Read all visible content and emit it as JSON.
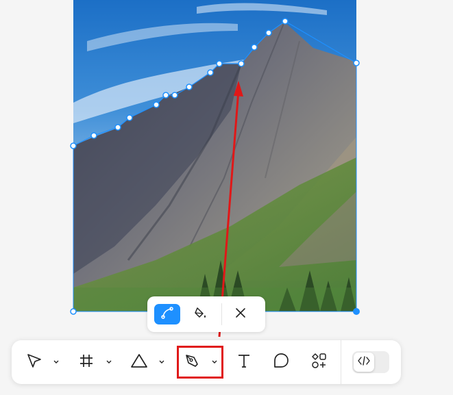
{
  "canvas": {
    "image_description_icon": "mountain-photo",
    "selection_color": "#1e90ff",
    "annotation_color": "#e01818"
  },
  "pen_subtoolbar": {
    "items": [
      {
        "name": "path-tool",
        "icon": "bezier-curve-icon",
        "active": true
      },
      {
        "name": "fill-tool",
        "icon": "paint-bucket-icon",
        "active": false
      },
      {
        "name": "close",
        "icon": "close-icon",
        "active": false
      }
    ]
  },
  "toolbar": {
    "tools": [
      {
        "name": "move",
        "icon": "cursor-arrow-icon",
        "has_dropdown": true
      },
      {
        "name": "frame",
        "icon": "frame-hash-icon",
        "has_dropdown": true
      },
      {
        "name": "shape",
        "icon": "triangle-icon",
        "has_dropdown": true
      },
      {
        "name": "pen",
        "icon": "pen-nib-icon",
        "has_dropdown": true,
        "selected": true
      },
      {
        "name": "text",
        "icon": "text-t-icon",
        "has_dropdown": false
      },
      {
        "name": "comment",
        "icon": "speech-bubble-icon",
        "has_dropdown": false
      },
      {
        "name": "actions",
        "icon": "components-plus-icon",
        "has_dropdown": false
      }
    ],
    "dev_mode": {
      "icon": "code-brackets-icon",
      "enabled": false
    }
  }
}
